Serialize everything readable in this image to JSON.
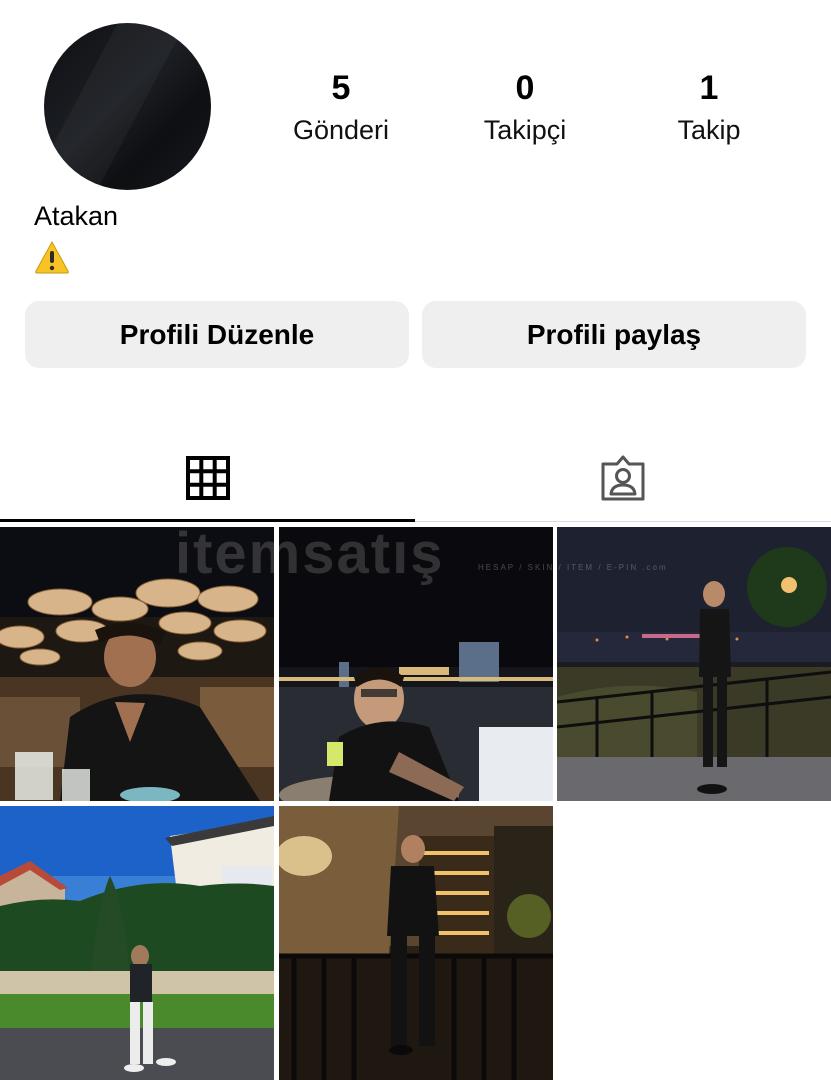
{
  "profile": {
    "name": "Atakan",
    "bio_icon": "warning-icon"
  },
  "stats": [
    {
      "value": "5",
      "label": "Gönderi"
    },
    {
      "value": "0",
      "label": "Takipçi"
    },
    {
      "value": "1",
      "label": "Takip"
    }
  ],
  "buttons": {
    "edit": "Profili Düzenle",
    "share": "Profili paylaş"
  },
  "tabs": [
    {
      "icon": "grid-icon",
      "active": true
    },
    {
      "icon": "tagged-person-icon",
      "active": false
    }
  ],
  "posts": [
    {
      "scene": "restaurant-night"
    },
    {
      "scene": "waterfront-night"
    },
    {
      "scene": "bosphorus-terrace"
    },
    {
      "scene": "garden-day"
    },
    {
      "scene": "bar-balcony"
    }
  ],
  "watermark": {
    "text": "itemsatış",
    "sub": "HESAP / SKIN / ITEM / E-PIN  .com"
  }
}
